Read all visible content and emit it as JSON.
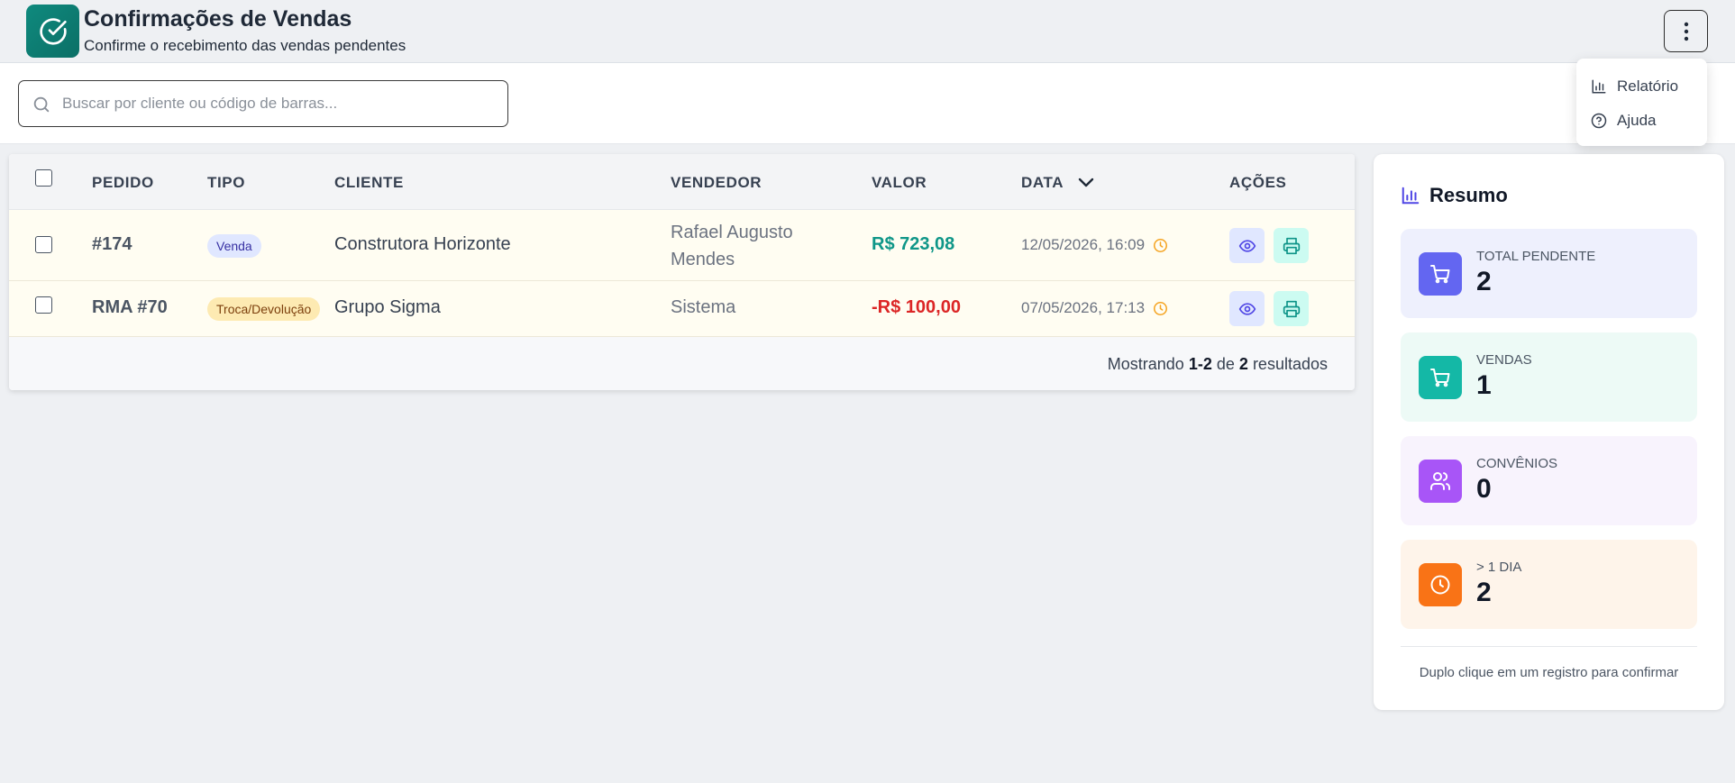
{
  "header": {
    "title": "Confirmações de Vendas",
    "subtitle": "Confirme o recebimento das vendas pendentes"
  },
  "search": {
    "placeholder": "Buscar por cliente ou código de barras..."
  },
  "menu": {
    "items": [
      {
        "label": "Relatório",
        "icon": "bar-chart-icon"
      },
      {
        "label": "Ajuda",
        "icon": "help-circle-icon"
      }
    ]
  },
  "table": {
    "columns": {
      "pedido": "PEDIDO",
      "tipo": "TIPO",
      "cliente": "CLIENTE",
      "vendedor": "VENDEDOR",
      "valor": "VALOR",
      "data": "DATA",
      "acoes": "AÇÕES"
    },
    "rows": [
      {
        "pedido": "#174",
        "tipo": "Venda",
        "cliente": "Construtora Horizonte",
        "vendedor": "Rafael Augusto Mendes",
        "valor": "R$ 723,08",
        "data": "12/05/2026, 16:09"
      },
      {
        "pedido": "RMA #70",
        "tipo": "Troca/Devolução",
        "cliente": "Grupo Sigma",
        "vendedor": "Sistema",
        "valor": "-R$ 100,00",
        "data": "07/05/2026, 17:13"
      }
    ],
    "footer": {
      "prefix": "Mostrando",
      "range": "1-2",
      "middle": "de",
      "total": "2",
      "suffix": "resultados"
    }
  },
  "summary": {
    "title": "Resumo",
    "stats": [
      {
        "label": "TOTAL PENDENTE",
        "value": "2",
        "icon": "cart-icon",
        "color": "#6366f1",
        "bg": "#eef0fd"
      },
      {
        "label": "VENDAS",
        "value": "1",
        "icon": "cart-icon",
        "color": "#14b8a6",
        "bg": "#edfaf6"
      },
      {
        "label": "CONVÊNIOS",
        "value": "0",
        "icon": "users-icon",
        "color": "#a855f7",
        "bg": "#f8f3fd"
      },
      {
        "label": "> 1 DIA",
        "value": "2",
        "icon": "clock-icon",
        "color": "#f97316",
        "bg": "#fef4ea"
      }
    ],
    "hint": "Duplo clique em um registro para confirmar"
  },
  "colors": {
    "brand": "#0f8a7e",
    "positive": "#0f9688",
    "negative": "#dc2626",
    "warning": "#f5a524"
  }
}
